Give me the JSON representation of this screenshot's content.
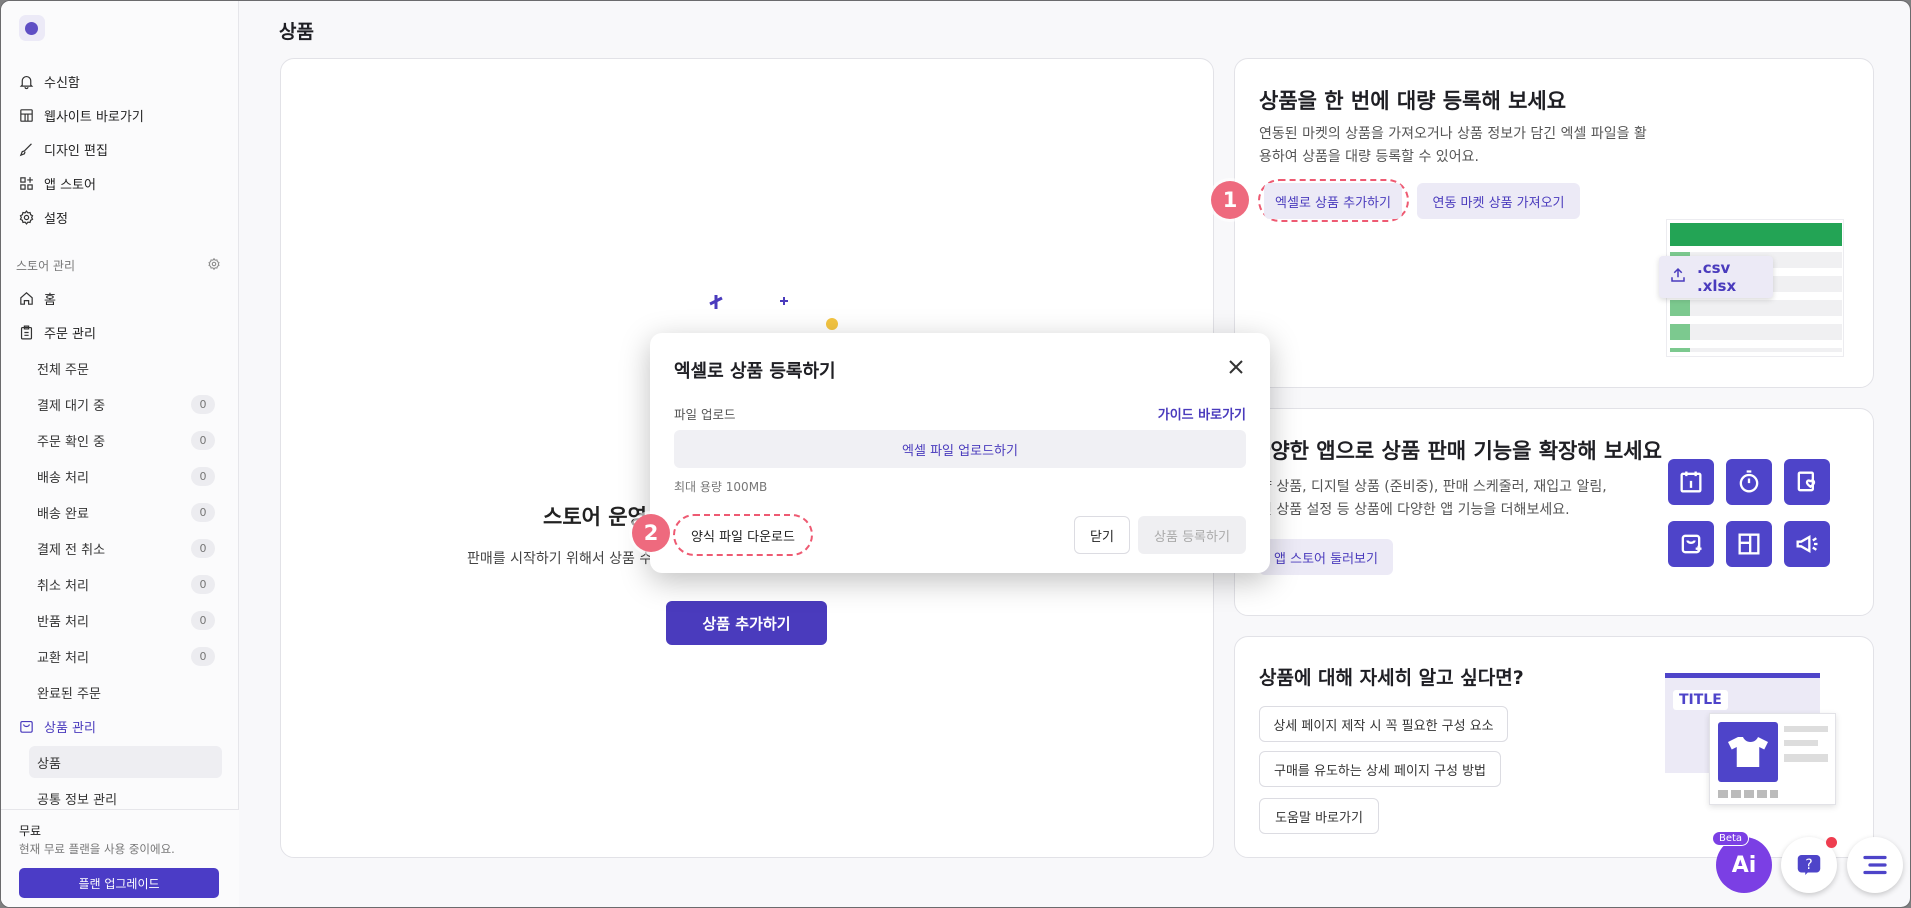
{
  "page": {
    "title": "상품"
  },
  "sidebar": {
    "top_items": [
      {
        "label": "수신함",
        "icon": "bell-icon"
      },
      {
        "label": "웹사이트 바로가기",
        "icon": "storefront-icon"
      },
      {
        "label": "디자인 편집",
        "icon": "brush-icon"
      },
      {
        "label": "앱 스토어",
        "icon": "apps-icon"
      },
      {
        "label": "설정",
        "icon": "gear-icon"
      }
    ],
    "section_label": "스토어 관리",
    "store_items": [
      {
        "label": "홈",
        "icon": "home-icon"
      },
      {
        "label": "주문 관리",
        "icon": "clipboard-icon"
      }
    ],
    "order_subitems": [
      {
        "label": "전체 주문",
        "count": ""
      },
      {
        "label": "결제 대기 중",
        "count": "0"
      },
      {
        "label": "주문 확인 중",
        "count": "0"
      },
      {
        "label": "배송 처리",
        "count": "0"
      },
      {
        "label": "배송 완료",
        "count": "0"
      },
      {
        "label": "결제 전 취소",
        "count": "0"
      },
      {
        "label": "취소 처리",
        "count": "0"
      },
      {
        "label": "반품 처리",
        "count": "0"
      },
      {
        "label": "교환 처리",
        "count": "0"
      },
      {
        "label": "완료된 주문",
        "count": ""
      }
    ],
    "product_section": {
      "label": "상품 관리",
      "icon": "box-icon"
    },
    "product_subitems": [
      {
        "label": "상품"
      },
      {
        "label": "공통 정보 관리"
      }
    ],
    "plan": {
      "name": "무료",
      "desc": "현재 무료 플랜을 사용 중이에요.",
      "upgrade": "플랜 업그레이드"
    }
  },
  "empty_state": {
    "heading": "스토어 운영",
    "desc": "판매를 시작하기 위해서 상품 수",
    "add_button": "상품 추가하기"
  },
  "bulk_card": {
    "title": "상품을 한 번에 대량 등록해 보세요",
    "desc_1": "연동된 마켓의 상품을 가져오거나 상품 정보가 담긴 엑셀 파일을 활",
    "desc_2": "용하여 상품을 대량 등록할 수 있어요.",
    "btn_excel": "엑셀로 상품 추가하기",
    "btn_market": "연동 마켓 상품 가져오기",
    "file_types": ".csv .xlsx",
    "marker": "1"
  },
  "apps_card": {
    "title": "다양한 앱으로 상품 판매 기능을 확장해 보세요",
    "desc_1": "약 상품, 디지털 상품 (준비중), 판매 스케줄러, 재입고 알림,",
    "desc_2": "련 상품 설정 등 상품에 다양한 앱 기능을 더해보세요.",
    "btn": "앱 스토어 둘러보기"
  },
  "learn_card": {
    "title": "상품에 대해 자세히 알고 싶다면?",
    "links": [
      "상세 페이지 제작 시 꼭 필요한 구성 요소",
      "구매를 유도하는 상세 페이지 구성 방법",
      "도움말 바로가기"
    ],
    "mock_title": "TITLE"
  },
  "modal": {
    "title": "엑셀로 상품 등록하기",
    "file_label": "파일 업로드",
    "guide_link": "가이드 바로가기",
    "upload_button": "엑셀 파일 업로드하기",
    "max_size": "최대 용량 100MB",
    "template_download": "양식 파일 다운로드",
    "close": "닫기",
    "submit": "상품 등록하기",
    "marker": "2"
  },
  "fab": {
    "ai_badge": "Beta",
    "ai_label": "Ai"
  },
  "colors": {
    "accent": "#4a3bbd",
    "marker": "#ee6a7e",
    "overlay": "#7f7f80"
  }
}
